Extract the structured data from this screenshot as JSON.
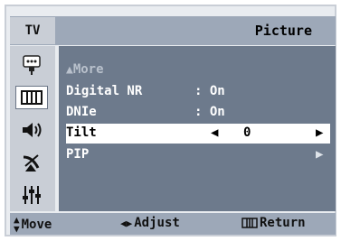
{
  "header": {
    "tab_label": "TV",
    "title": "Picture"
  },
  "sidebar": {
    "items": [
      {
        "icon": "input-icon"
      },
      {
        "icon": "picture-icon",
        "active": true
      },
      {
        "icon": "sound-icon"
      },
      {
        "icon": "channel-icon"
      },
      {
        "icon": "setup-icon"
      }
    ]
  },
  "menu": {
    "more_label": "More",
    "items": [
      {
        "label": "Digital NR",
        "value": ": On"
      },
      {
        "label": "DNIe",
        "value": ": On"
      },
      {
        "label": "Tilt",
        "value": "0"
      },
      {
        "label": "PIP",
        "value": ""
      }
    ]
  },
  "footer": {
    "move": "Move",
    "adjust": "Adjust",
    "return": "Return"
  },
  "colors": {
    "header": "#9da8b8",
    "menu_bg": "#6d7a8c",
    "selected_bg": "#ffffff",
    "sidebar": "#c9ced6"
  }
}
